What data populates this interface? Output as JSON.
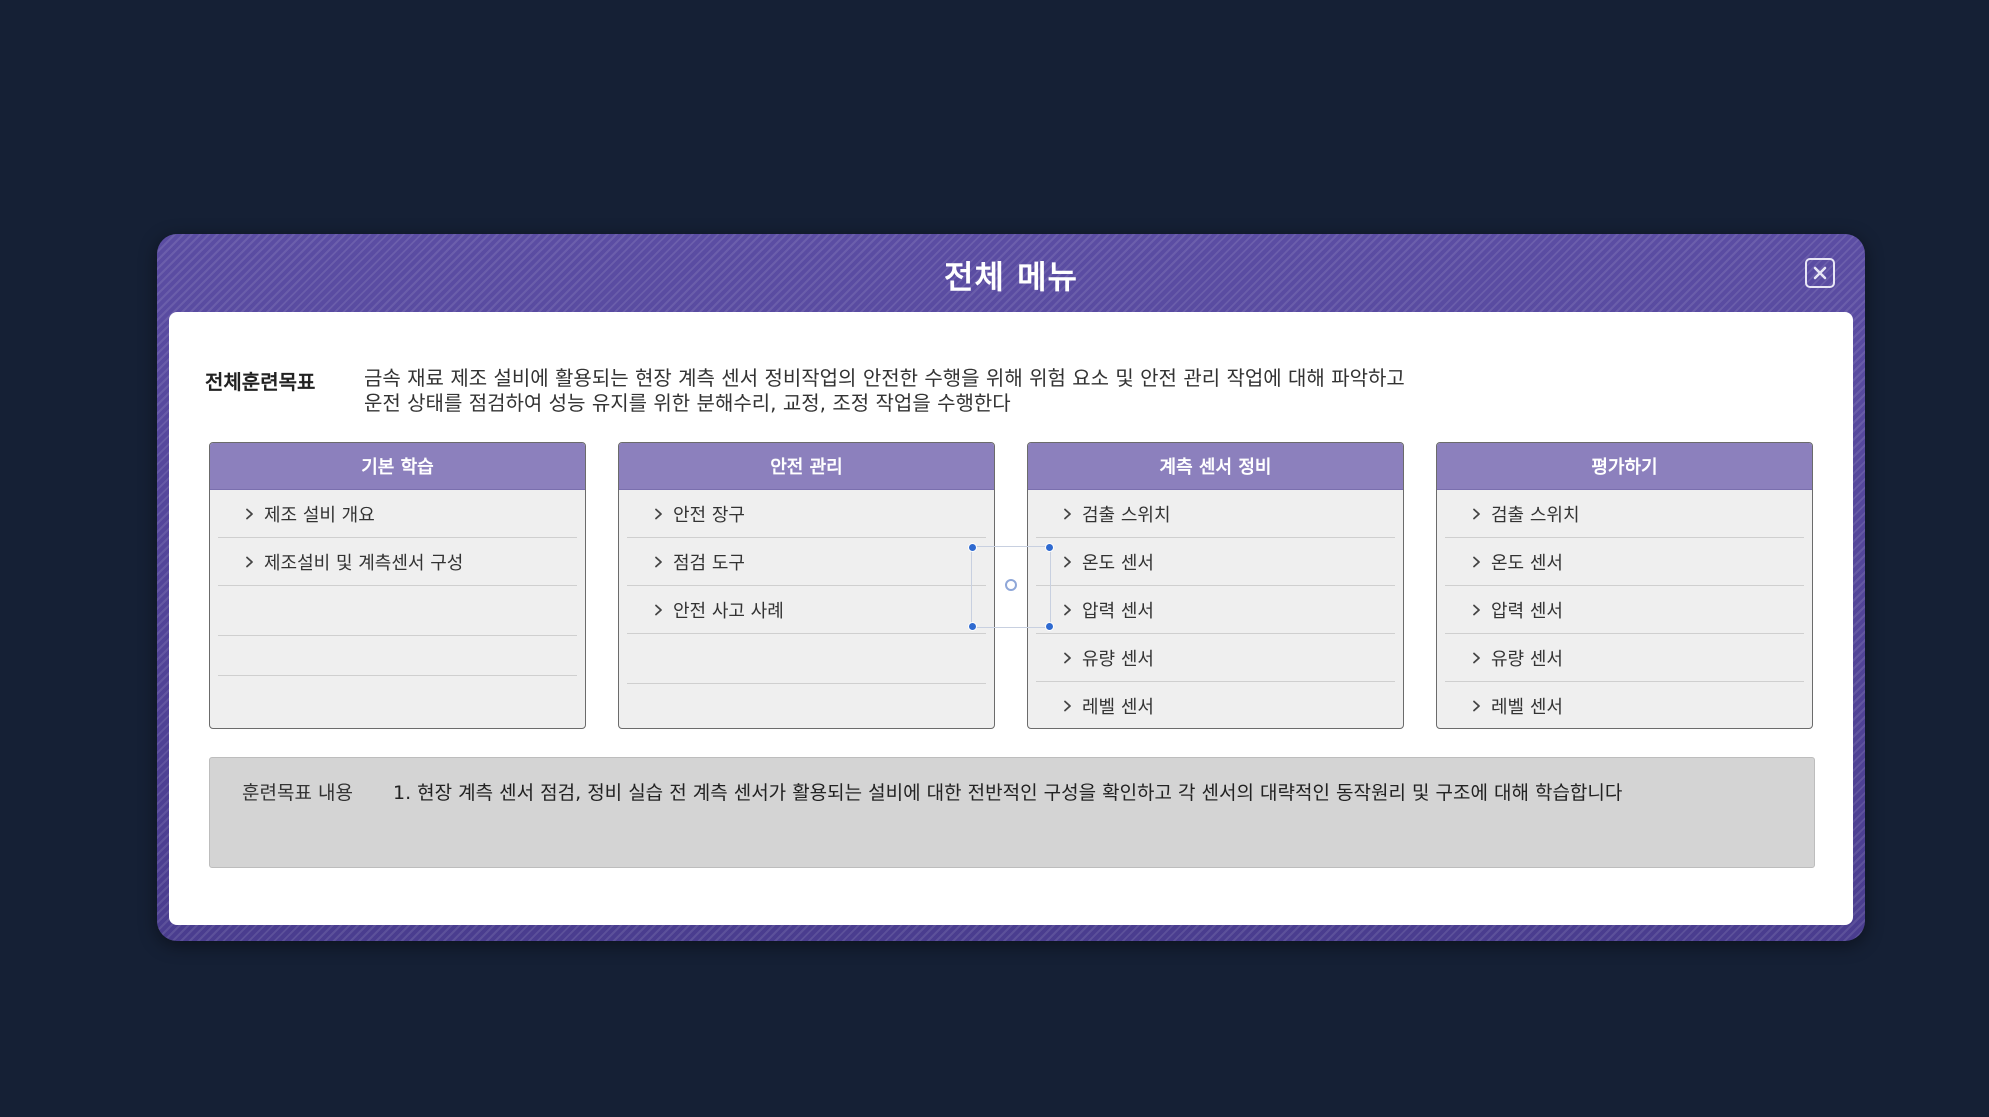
{
  "modal": {
    "title": "전체 메뉴",
    "close_icon": "close-icon"
  },
  "overall_goal": {
    "label": "전체훈련목표",
    "lines": [
      "금속 재료 제조 설비에 활용되는 현장 계측 센서 정비작업의 안전한 수행을 위해 위험 요소 및 안전 관리 작업에 대해 파악하고",
      "운전 상태를 점검하여 성능 유지를 위한 분해수리, 교정, 조정 작업을 수행한다"
    ]
  },
  "columns": [
    {
      "title": "기본 학습",
      "items": [
        "제조 설비 개요",
        "제조설비 및 계측센서 구성"
      ]
    },
    {
      "title": "안전 관리",
      "items": [
        "안전 장구",
        "점검 도구",
        "안전 사고 사례"
      ]
    },
    {
      "title": "계측 센서 정비",
      "items": [
        "검출 스위치",
        "온도 센서",
        "압력 센서",
        "유량 센서",
        "레벨 센서"
      ]
    },
    {
      "title": "평가하기",
      "items": [
        "검출 스위치",
        "온도 센서",
        "압력 센서",
        "유량 센서",
        "레벨 센서"
      ]
    }
  ],
  "content": {
    "label": "훈련목표 내용",
    "text": "1. 현장 계측 센서 점검, 정비 실습 전 계측 센서가 활용되는 설비에 대한 전반적인 구성을 확인하고 각 센서의 대략적인 동작원리 및 구조에 대해 학습합니다"
  },
  "colors": {
    "background": "#152035",
    "modal_frame": "#4f4296",
    "column_header": "#8c80bd",
    "content_box": "#d4d4d4"
  }
}
